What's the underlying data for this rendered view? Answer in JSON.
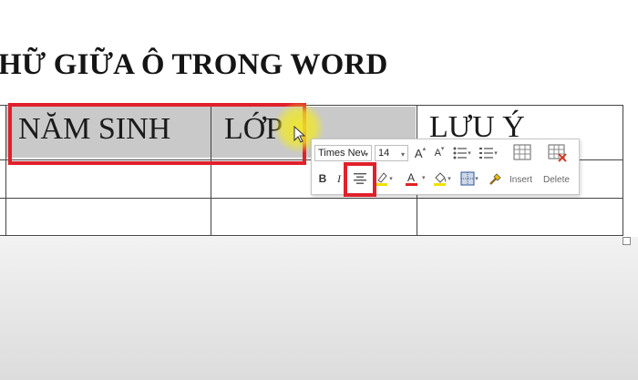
{
  "heading": "HỮ GIỮA Ô TRONG WORD",
  "table": {
    "headers": [
      "NĂM SINH",
      "LỚP",
      "LƯU Ý"
    ]
  },
  "mini_toolbar": {
    "font_name": "Times Nev",
    "font_size": "14",
    "grow_font_label": "A",
    "shrink_font_label": "A",
    "bold_label": "B",
    "italic_label": "I",
    "font_color_label": "A",
    "insert_label": "Insert",
    "delete_label": "Delete",
    "colors": {
      "font_color_underline": "#e02020",
      "highlight_underline": "#f0e000",
      "accent": "#2b5797"
    }
  },
  "highlight_colors": {
    "red_box": "#e0202a",
    "cursor_highlight": "#f0e828",
    "cell_shading": "#c9c9c9"
  }
}
